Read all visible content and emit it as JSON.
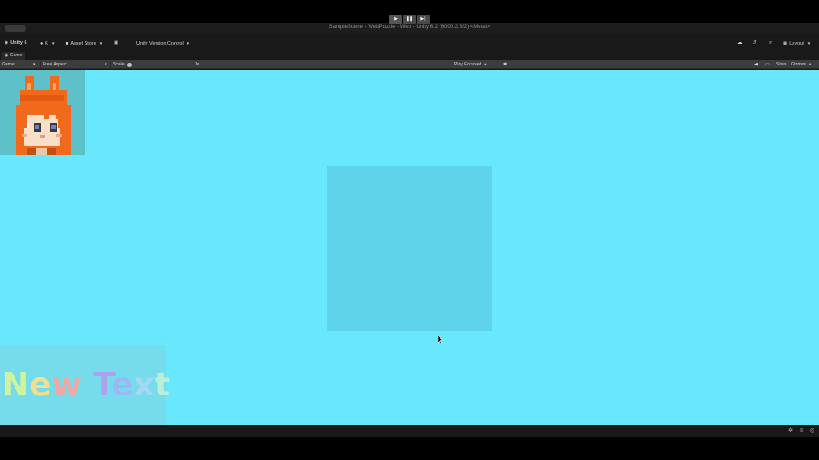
{
  "window": {
    "title": "SampleScene - WebPuzzle - Web - Unity 6.2 (6000.2.6f2) <Metal>"
  },
  "toolbar": {
    "unity_label": "Unity 6",
    "account_label": "K",
    "asset_store_label": "Asset Store",
    "version_control_label": "Unity Version Control",
    "layout_label": "Layout",
    "play_icon": "play-icon",
    "pause_icon": "pause-icon",
    "step_icon": "step-icon"
  },
  "tabs": {
    "game_tab": "Game"
  },
  "game_controls": {
    "display_select": "Game",
    "aspect_select": "Free Aspect",
    "scale_label": "Scale",
    "scale_value": "1x",
    "play_mode_select": "Play Focused",
    "stats_label": "Stats",
    "gizmos_label": "Gizmos"
  },
  "game_view": {
    "background_color": "#69e7fd",
    "text_object": {
      "text": "New Text",
      "letters": [
        "N",
        "e",
        "w",
        " ",
        "T",
        "e",
        "x",
        "t"
      ],
      "colors": [
        "#d6f59a",
        "#f7e08a",
        "#f7a6a0",
        "",
        "#b39ef0",
        "#9fb7f5",
        "#a8d8f5",
        "#bff0d8"
      ]
    }
  },
  "statusbar": {
    "icons": [
      "bug-icon",
      "layers-icon",
      "settings-icon"
    ]
  }
}
